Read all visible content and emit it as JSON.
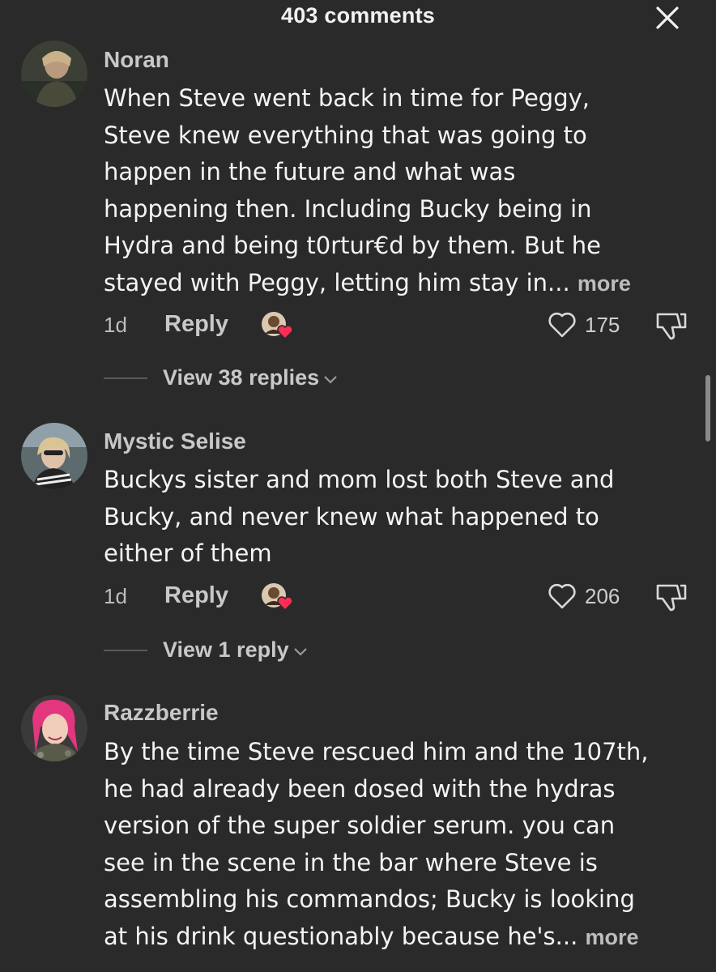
{
  "header": {
    "title": "403 comments",
    "close_icon": "close-icon"
  },
  "comments": [
    {
      "username": "Noran",
      "avatar_icon": "user-avatar",
      "lines": [
        "When Steve went back in time for Peggy,",
        "Steve knew everything that was going to",
        "happen in the future and what was",
        "happening then. Including Bucky being in",
        "Hydra and being t0rtur€d by them. But he",
        "stayed with Peggy, letting him stay in..."
      ],
      "more_label": "more",
      "time": "1d",
      "reply_label": "Reply",
      "likes": "175",
      "view_replies": "View 38 replies"
    },
    {
      "username": "Mystic Selise",
      "avatar_icon": "user-avatar",
      "lines": [
        "Buckys sister and mom lost both Steve and",
        "Bucky, and never knew what happened to",
        "either of them"
      ],
      "more_label": "",
      "time": "1d",
      "reply_label": "Reply",
      "likes": "206",
      "view_replies": "View 1 reply"
    },
    {
      "username": "Razzberrie",
      "avatar_icon": "user-avatar",
      "lines": [
        "By the time Steve rescued him and the 107th,",
        "he had already been dosed with the hydras",
        "version of the super soldier serum. you can",
        "see in the scene in the bar where Steve is",
        "assembling his commandos; Bucky is looking",
        "at his drink questionably because he's..."
      ],
      "more_label": "more"
    }
  ],
  "colors": {
    "background": "#2a2a2a",
    "text": "#f4f4f4",
    "secondary": "#c8c8c8",
    "heart_badge": "#ff2c55"
  },
  "icons": [
    "close-icon",
    "heart-outline-icon",
    "dislike-icon",
    "chevron-down-icon",
    "creator-liked-heart-icon"
  ]
}
